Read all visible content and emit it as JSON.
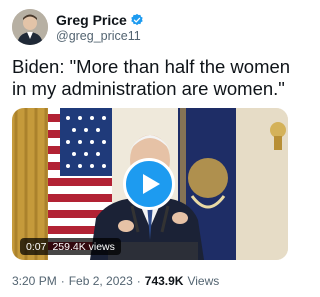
{
  "author": {
    "display_name": "Greg Price",
    "handle": "@greg_price11",
    "verified_icon": "verified-badge-icon",
    "verified_color": "#1d9bf0"
  },
  "tweet": {
    "text": "Biden: \"More than half the women in my administration are women.\""
  },
  "video": {
    "duration": "0:07",
    "views": "259.4K views",
    "play_icon": "play-icon",
    "play_color": "#1d9bf0"
  },
  "meta": {
    "time": "3:20 PM",
    "separator": "·",
    "date": "Feb 2, 2023",
    "views_count": "743.9K",
    "views_label": "Views"
  }
}
